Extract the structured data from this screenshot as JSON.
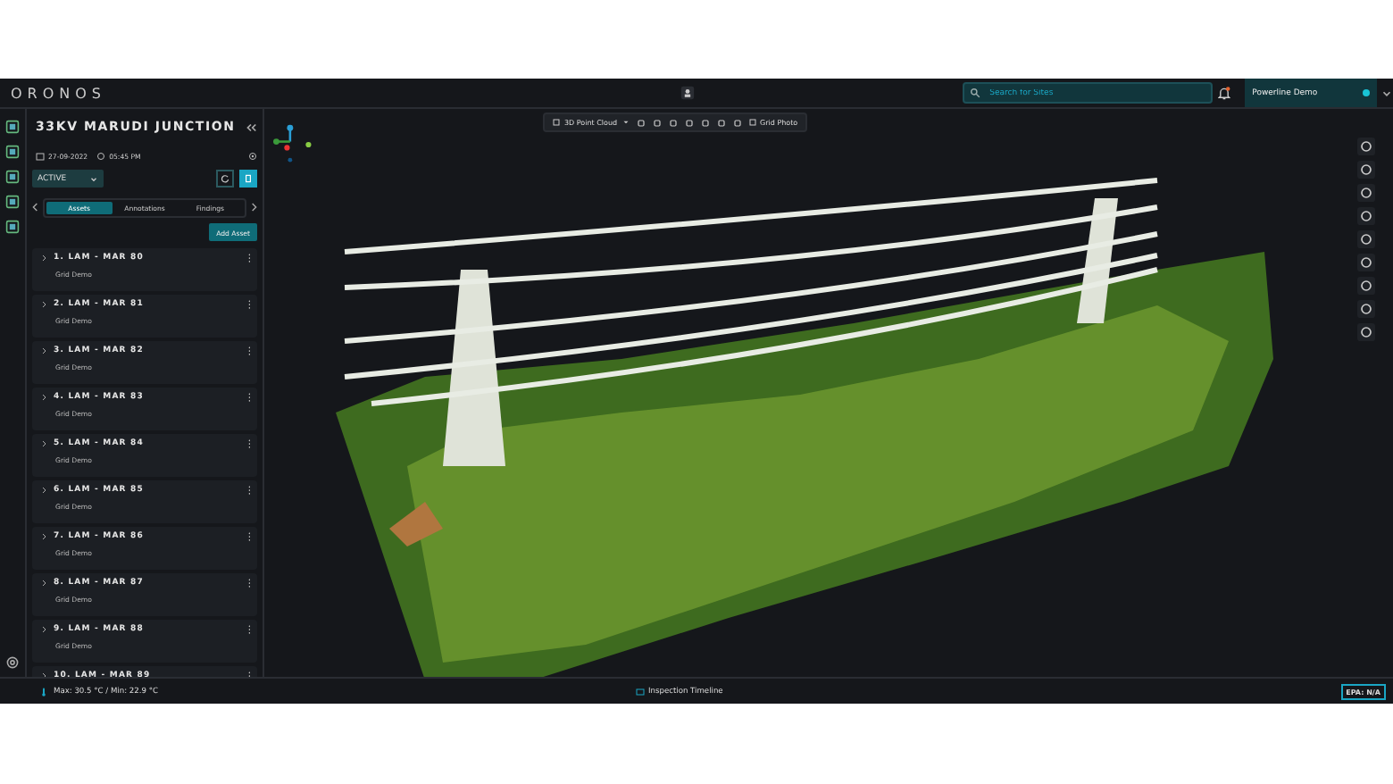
{
  "app": {
    "logo": "ORONOS"
  },
  "header": {
    "search": {
      "placeholder": "Search for Sites"
    },
    "notifications": {
      "unread": true
    },
    "project": {
      "name": "Powerline Demo",
      "online": true
    }
  },
  "panel": {
    "title": "33KV MARUDI JUNCTION",
    "date": "27-09-2022",
    "time": "05:45 PM",
    "status": "ACTIVE",
    "tabs": [
      {
        "label": "Assets",
        "selected": true
      },
      {
        "label": "Annotations",
        "selected": false
      },
      {
        "label": "Findings",
        "selected": false
      }
    ],
    "add_button": "Add Asset",
    "assets": [
      {
        "name": "1. LAM - MAR 80",
        "subtitle": "Grid Demo"
      },
      {
        "name": "2. LAM - MAR 81",
        "subtitle": "Grid Demo"
      },
      {
        "name": "3. LAM - MAR 82",
        "subtitle": "Grid Demo"
      },
      {
        "name": "4. LAM - MAR 83",
        "subtitle": "Grid Demo"
      },
      {
        "name": "5. LAM - MAR 84",
        "subtitle": "Grid Demo"
      },
      {
        "name": "6. LAM - MAR 85",
        "subtitle": "Grid Demo"
      },
      {
        "name": "7. LAM - MAR 86",
        "subtitle": "Grid Demo"
      },
      {
        "name": "8. LAM - MAR 87",
        "subtitle": "Grid Demo"
      },
      {
        "name": "9. LAM - MAR 88",
        "subtitle": "Grid Demo"
      },
      {
        "name": "10. LAM - MAR 89"
      }
    ]
  },
  "toolbar": {
    "view": "3D Point Cloud",
    "photo_button": "Grid Photo"
  },
  "status_bar": {
    "temperature": "Max: 30.5 °C / Min: 22.9 °C",
    "timeline": "Inspection Timeline",
    "epa": "EPA: N/A"
  }
}
